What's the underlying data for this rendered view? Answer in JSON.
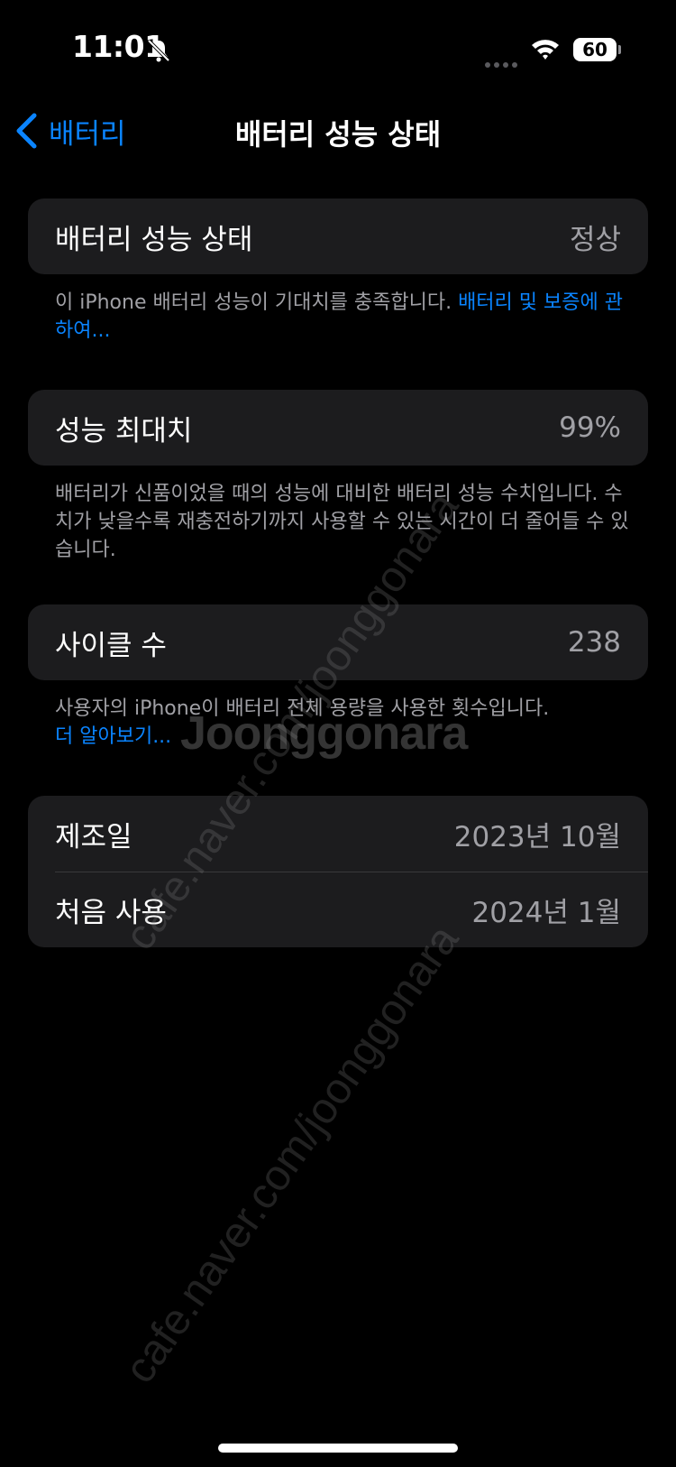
{
  "status_bar": {
    "time": "11:01",
    "battery_level": "60"
  },
  "nav": {
    "back_label": "배터리",
    "title": "배터리 성능 상태"
  },
  "sections": {
    "health": {
      "label": "배터리 성능 상태",
      "value": "정상",
      "footnote_text": "이 iPhone 배터리 성능이 기대치를 충족합니다. ",
      "footnote_link": "배터리 및 보증에 관하여..."
    },
    "max_capacity": {
      "label": "성능 최대치",
      "value": "99%",
      "footnote_text": "배터리가 신품이었을 때의 성능에 대비한 배터리 성능 수치입니다. 수치가 낮을수록 재충전하기까지 사용할 수 있는 시간이 더 줄어들 수 있습니다."
    },
    "cycle_count": {
      "label": "사이클 수",
      "value": "238",
      "footnote_text": "사용자의 iPhone이 배터리 전체 용량을 사용한 횟수입니다.",
      "footnote_link": "더 알아보기..."
    },
    "dates": {
      "manufacture_label": "제조일",
      "manufacture_value": "2023년 10월",
      "first_use_label": "처음 사용",
      "first_use_value": "2024년 1월"
    }
  },
  "watermark": {
    "text": "cafe.naver.com/joonggonara",
    "logo": "Joonggonara"
  },
  "colors": {
    "background": "#000000",
    "card": "#1c1c1e",
    "accent": "#0a84ff",
    "secondary_text": "#a0a0a5"
  }
}
